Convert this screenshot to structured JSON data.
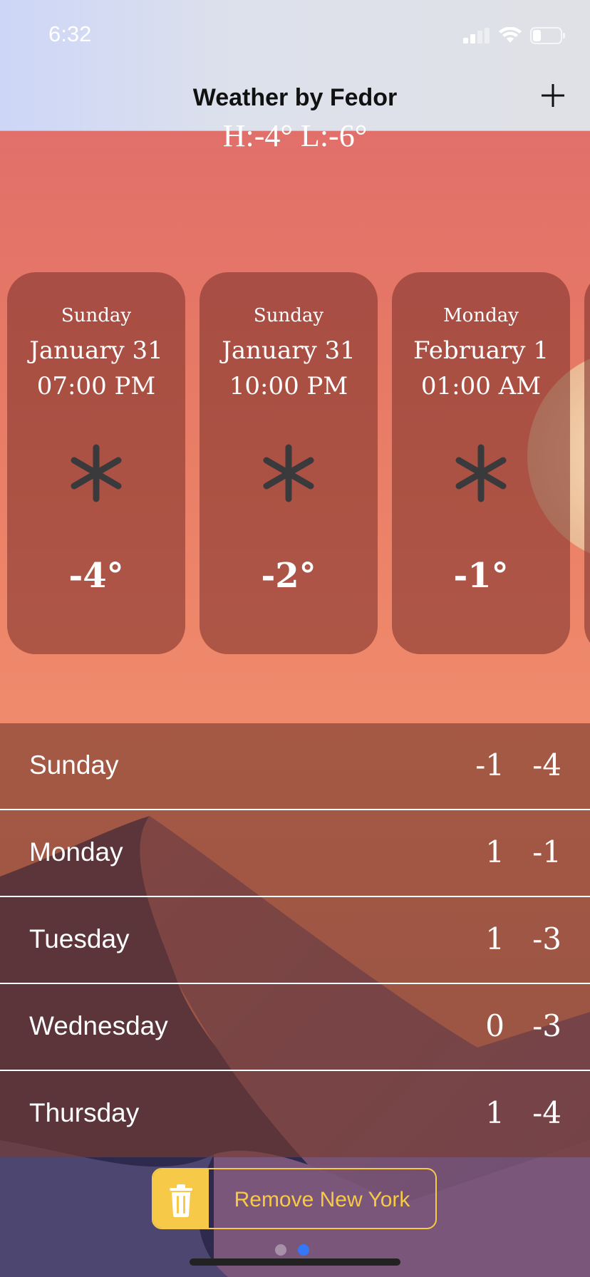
{
  "status": {
    "time": "6:32"
  },
  "nav": {
    "title": "Weather by Fedor",
    "add_icon": "plus-icon"
  },
  "current": {
    "hilo": "H:-4° L:-6°"
  },
  "hourly": [
    {
      "day": "Sunday",
      "date": "January 31",
      "time": "07:00 PM",
      "icon": "snowflake-icon",
      "temp": "-4°"
    },
    {
      "day": "Sunday",
      "date": "January 31",
      "time": "10:00 PM",
      "icon": "snowflake-icon",
      "temp": "-2°"
    },
    {
      "day": "Monday",
      "date": "February 1",
      "time": "01:00 AM",
      "icon": "snowflake-icon",
      "temp": "-1°"
    }
  ],
  "daily": [
    {
      "day": "Sunday",
      "high": "-1",
      "low": "-4"
    },
    {
      "day": "Monday",
      "high": "1",
      "low": "-1"
    },
    {
      "day": "Tuesday",
      "high": "1",
      "low": "-3"
    },
    {
      "day": "Wednesday",
      "high": "0",
      "low": "-3"
    },
    {
      "day": "Thursday",
      "high": "1",
      "low": "-4"
    }
  ],
  "remove_button": {
    "label": "Remove New York",
    "icon": "trash-icon"
  },
  "page_indicator": {
    "pages": 2,
    "current": 2
  },
  "colors": {
    "accent": "#f7c948",
    "active_dot": "#3478f6"
  }
}
